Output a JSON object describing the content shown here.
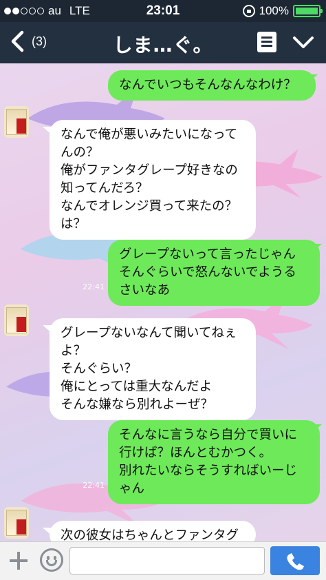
{
  "status": {
    "carrier": "au",
    "network": "LTE",
    "time": "23:01",
    "battery": "100%",
    "battery_level": 1.0
  },
  "header": {
    "back_count": "(3)",
    "title": "しま…ぐ。"
  },
  "messages": [
    {
      "side": "out",
      "text": "なんでいつもそんなんなわけ？"
    },
    {
      "side": "in",
      "text": "なんで俺が悪いみたいになってんの？\n俺がファンタグレープ好きなの知ってんだろ？\nなんでオレンジ買って来たの？は？"
    },
    {
      "side": "out",
      "text": "グレープないって言ったじゃん\nそんぐらいで怒んないでようるさいなあ"
    },
    {
      "side": "in",
      "text": "グレープないなんて聞いてねぇよ？\nそんぐらい？\n俺にとっては重大なんだよ\nそんな嫌なら別れよーぜ？"
    },
    {
      "side": "out",
      "text": "そんなに言うなら自分で買いに行けば？ほんとむかつく。\n別れたいならそうすればいーじゃん"
    },
    {
      "side": "in",
      "text": "次の彼女はちゃんとファンタグ"
    }
  ],
  "meta": {
    "m3_time": "22:41",
    "m5_time": "22:41"
  },
  "input": {
    "value": ""
  },
  "colors": {
    "header_bg": "#223040",
    "outgoing_bubble": "#6ee95a",
    "incoming_bubble": "#ffffff",
    "call_button": "#3b83e0",
    "battery": "#4cd964"
  },
  "icons": {
    "back": "chevron-left-icon",
    "menu": "note-list-icon",
    "more": "chevron-down-icon",
    "plus": "plus-icon",
    "emoji": "smiley-icon",
    "call": "phone-icon"
  }
}
